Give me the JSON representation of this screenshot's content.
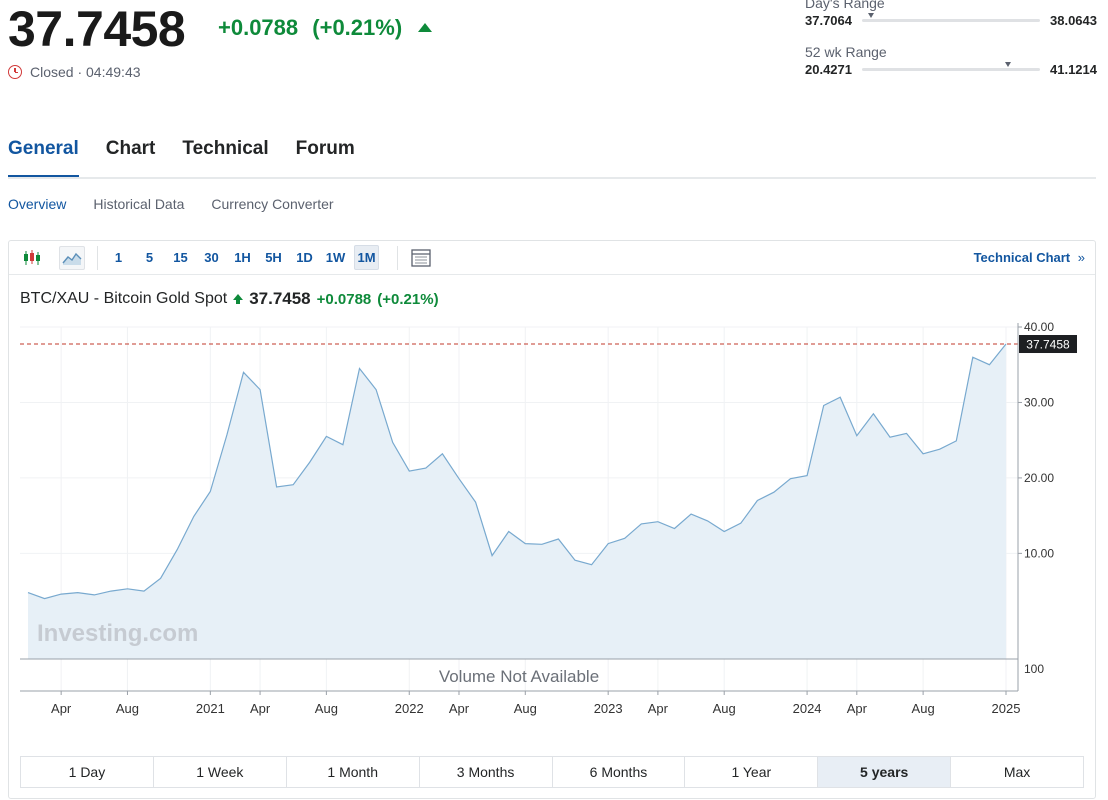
{
  "quote": {
    "price": "37.7458",
    "change": "+0.0788",
    "change_pct": "(+0.21%)",
    "status": "Closed · 04:49:43",
    "up_color": "#0e8a3a"
  },
  "days_range": {
    "label": "Day's Range",
    "low": "37.7064",
    "high": "38.0643",
    "position": 0.05
  },
  "wk52_range": {
    "label": "52 wk Range",
    "low": "20.4271",
    "high": "41.1214",
    "position": 0.82
  },
  "tabs": [
    {
      "label": "General",
      "active": true
    },
    {
      "label": "Chart",
      "active": false
    },
    {
      "label": "Technical",
      "active": false
    },
    {
      "label": "Forum",
      "active": false
    }
  ],
  "subtabs": [
    {
      "label": "Overview",
      "active": true
    },
    {
      "label": "Historical Data",
      "active": false
    },
    {
      "label": "Currency Converter",
      "active": false
    }
  ],
  "toolbar": {
    "icons": [
      "candlestick-icon",
      "area-chart-icon",
      "indicator-icon"
    ],
    "intervals": [
      "1",
      "5",
      "15",
      "30",
      "1H",
      "5H",
      "1D",
      "1W",
      "1M"
    ],
    "active_interval": "1M",
    "link_label": "Technical Chart",
    "link_suffix": "»"
  },
  "chart_header": {
    "name": "BTC/XAU - Bitcoin Gold Spot",
    "price": "37.7458",
    "change": "+0.0788",
    "change_pct": "(+0.21%)"
  },
  "chart_data": {
    "type": "area",
    "x": [
      "2020-02",
      "2020-03",
      "2020-04",
      "2020-05",
      "2020-06",
      "2020-07",
      "2020-08",
      "2020-09",
      "2020-10",
      "2020-11",
      "2020-12",
      "2021-01",
      "2021-02",
      "2021-03",
      "2021-04",
      "2021-05",
      "2021-06",
      "2021-07",
      "2021-08",
      "2021-09",
      "2021-10",
      "2021-11",
      "2021-12",
      "2022-01",
      "2022-02",
      "2022-03",
      "2022-04",
      "2022-05",
      "2022-06",
      "2022-07",
      "2022-08",
      "2022-09",
      "2022-10",
      "2022-11",
      "2022-12",
      "2023-01",
      "2023-02",
      "2023-03",
      "2023-04",
      "2023-05",
      "2023-06",
      "2023-07",
      "2023-08",
      "2023-09",
      "2023-10",
      "2023-11",
      "2023-12",
      "2024-01",
      "2024-02",
      "2024-03",
      "2024-04",
      "2024-05",
      "2024-06",
      "2024-07",
      "2024-08",
      "2024-09",
      "2024-10",
      "2024-11",
      "2024-12",
      "2025-01"
    ],
    "values": [
      4.8,
      4.0,
      4.6,
      4.8,
      4.5,
      5.0,
      5.3,
      5.0,
      6.7,
      10.5,
      14.9,
      18.2,
      25.7,
      34.0,
      31.7,
      18.8,
      19.1,
      22.1,
      25.5,
      24.4,
      34.5,
      31.7,
      24.7,
      20.9,
      21.3,
      23.2,
      19.9,
      16.8,
      9.7,
      12.9,
      11.3,
      11.2,
      11.9,
      9.1,
      8.5,
      11.3,
      12.0,
      13.9,
      14.2,
      13.3,
      15.2,
      14.3,
      12.9,
      14.0,
      17.0,
      18.1,
      19.9,
      20.3,
      29.6,
      30.7,
      25.6,
      28.5,
      25.4,
      25.9,
      23.2,
      23.8,
      24.9,
      36.0,
      35.0,
      37.7458
    ],
    "x_tick_labels": [
      "Apr",
      "Aug",
      "2021",
      "Apr",
      "Aug",
      "2022",
      "Apr",
      "Aug",
      "2023",
      "Apr",
      "Aug",
      "2024",
      "Apr",
      "Aug",
      "2025"
    ],
    "x_tick_dates": [
      "2020-04",
      "2020-08",
      "2021-01",
      "2021-04",
      "2021-08",
      "2022-01",
      "2022-04",
      "2022-08",
      "2023-01",
      "2023-04",
      "2023-08",
      "2024-01",
      "2024-04",
      "2024-08",
      "2025-01"
    ],
    "y_ticks": [
      "10.00",
      "20.00",
      "30.00",
      "40.00"
    ],
    "ylim": [
      -4.0,
      40.0
    ],
    "current_value_label": "37.7458",
    "volume_text": "Volume Not Available",
    "volume_axis_label": "100",
    "watermark": "Investing.com",
    "line_color": "#78a9cf",
    "fill_color": "#e7f0f7",
    "price_line_color": "#c0392b"
  },
  "periods": [
    {
      "label": "1 Day",
      "active": false
    },
    {
      "label": "1 Week",
      "active": false
    },
    {
      "label": "1 Month",
      "active": false
    },
    {
      "label": "3 Months",
      "active": false
    },
    {
      "label": "6 Months",
      "active": false
    },
    {
      "label": "1 Year",
      "active": false
    },
    {
      "label": "5 years",
      "active": true
    },
    {
      "label": "Max",
      "active": false
    }
  ]
}
